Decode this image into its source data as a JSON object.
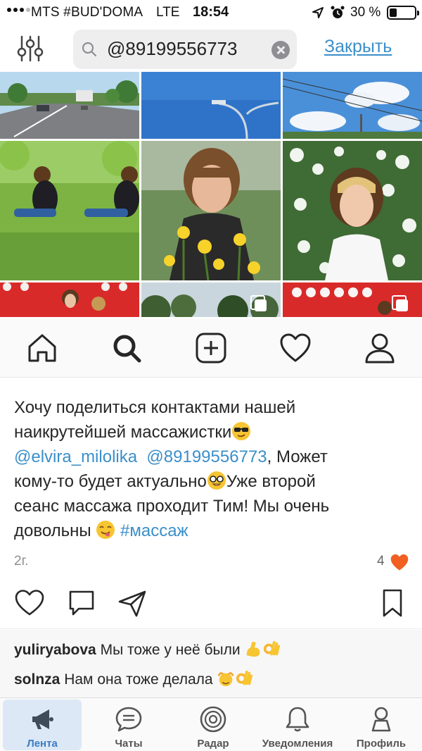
{
  "status_bar": {
    "carrier": "MTS #BUD'DOMA",
    "network": "LTE",
    "time": "18:54",
    "battery": "30 %",
    "icons": [
      "signal-dots",
      "location-arrow-icon",
      "alarm-icon",
      "battery-icon"
    ]
  },
  "search": {
    "value": "@89199556773",
    "close_label": "Закрыть",
    "icons": [
      "filter-sliders-icon",
      "search-icon",
      "clear-icon"
    ]
  },
  "photo_grid": {
    "rows": [
      [
        "road",
        "sky-streetlight",
        "sky-clouds"
      ],
      [
        "woman-on-grass",
        "woman-with-dandelions",
        "woman-with-blossoms"
      ],
      [
        "red-balloons",
        "trees-multi",
        "red-balloons-multi"
      ]
    ]
  },
  "ig_nav": {
    "icons": [
      "home-icon",
      "search-icon",
      "add-post-icon",
      "heart-icon",
      "profile-icon"
    ],
    "active": "search-icon"
  },
  "post": {
    "caption_line1": "Хочу поделиться контактами нашей",
    "caption_line2": "наикрутейшей массажистки",
    "mention1": "@elvira_milolika",
    "mention2": "@89199556773",
    "caption_line3_rest": ", Может",
    "caption_line4": "кому-то будет актуально",
    "caption_line4_rest": "Уже второй",
    "caption_line5": "сеанс массажа проходит Тим! Мы очень",
    "caption_line6": "довольны",
    "hashtag": "#массаж",
    "date": "2г.",
    "likes": "4",
    "accent_color": "#3b8fc9",
    "heart_color": "#f25f22"
  },
  "comments": [
    {
      "user": "yuliryabova",
      "text": "Мы тоже у неё были"
    },
    {
      "user": "solnza",
      "text": "Нам она тоже делала"
    }
  ],
  "tab_bar": {
    "tabs": [
      {
        "label": "Лента",
        "icon": "megaphone-icon",
        "active": true
      },
      {
        "label": "Чаты",
        "icon": "chat-bubble-icon",
        "active": false
      },
      {
        "label": "Радар",
        "icon": "radar-icon",
        "active": false
      },
      {
        "label": "Уведомления",
        "icon": "bell-icon",
        "active": false
      },
      {
        "label": "Профиль",
        "icon": "person-icon",
        "active": false
      }
    ]
  }
}
